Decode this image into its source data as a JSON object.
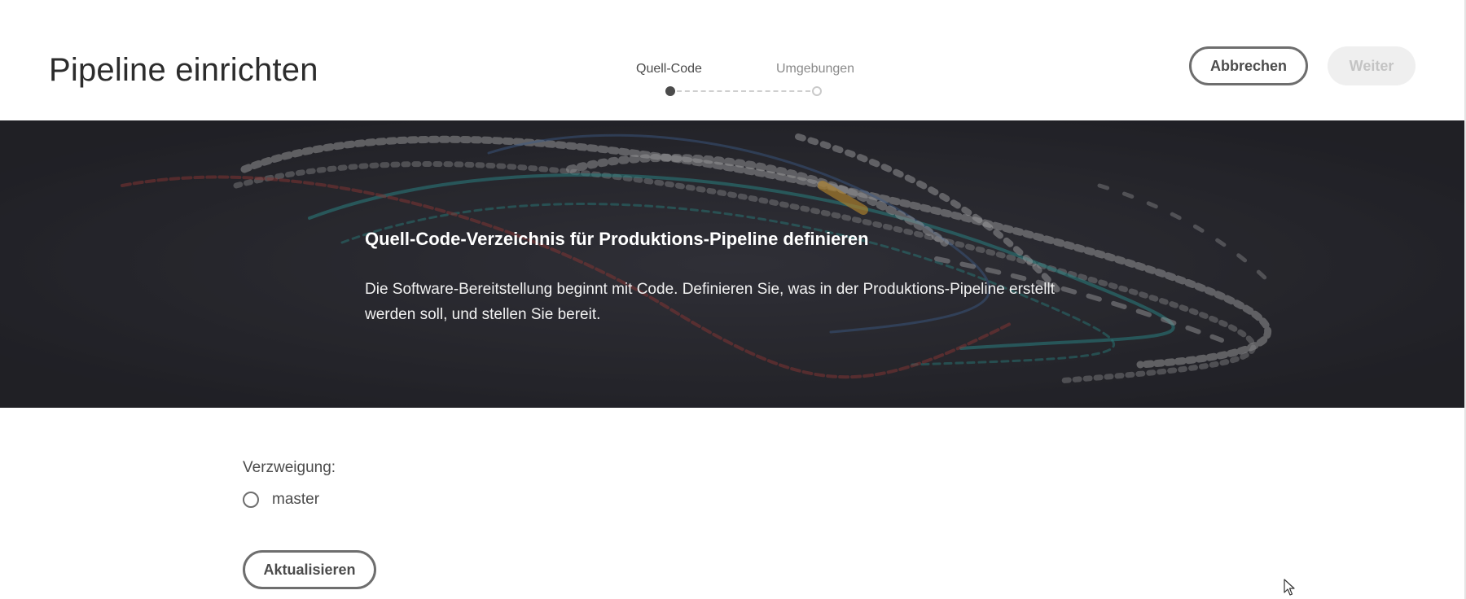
{
  "header": {
    "title": "Pipeline einrichten",
    "steps": [
      {
        "label": "Quell-Code",
        "state": "active"
      },
      {
        "label": "Umgebungen",
        "state": "inactive"
      }
    ],
    "cancel_label": "Abbrechen",
    "next_label": "Weiter"
  },
  "hero": {
    "title": "Quell-Code-Verzeichnis für Produktions-Pipeline definieren",
    "description": "Die Software-Bereitstellung beginnt mit Code. Definieren Sie, was in der Produktions-Pipeline erstellt werden soll, und stellen Sie bereit."
  },
  "form": {
    "branch_label": "Verzweigung:",
    "branches": [
      {
        "label": "master",
        "selected": false
      }
    ],
    "update_label": "Aktualisieren"
  },
  "colors": {
    "text": "#2c2c2c",
    "button_border": "#6e6e6e",
    "disabled_bg": "#efefef",
    "hero_bg": "#2a2a30",
    "accent_teal": "#2fb5b0",
    "accent_red": "#c2423c"
  },
  "icons": {
    "step_done": "filled-circle-icon",
    "step_todo": "empty-circle-icon",
    "radio": "radio-button-icon",
    "cursor": "mouse-pointer-icon"
  }
}
